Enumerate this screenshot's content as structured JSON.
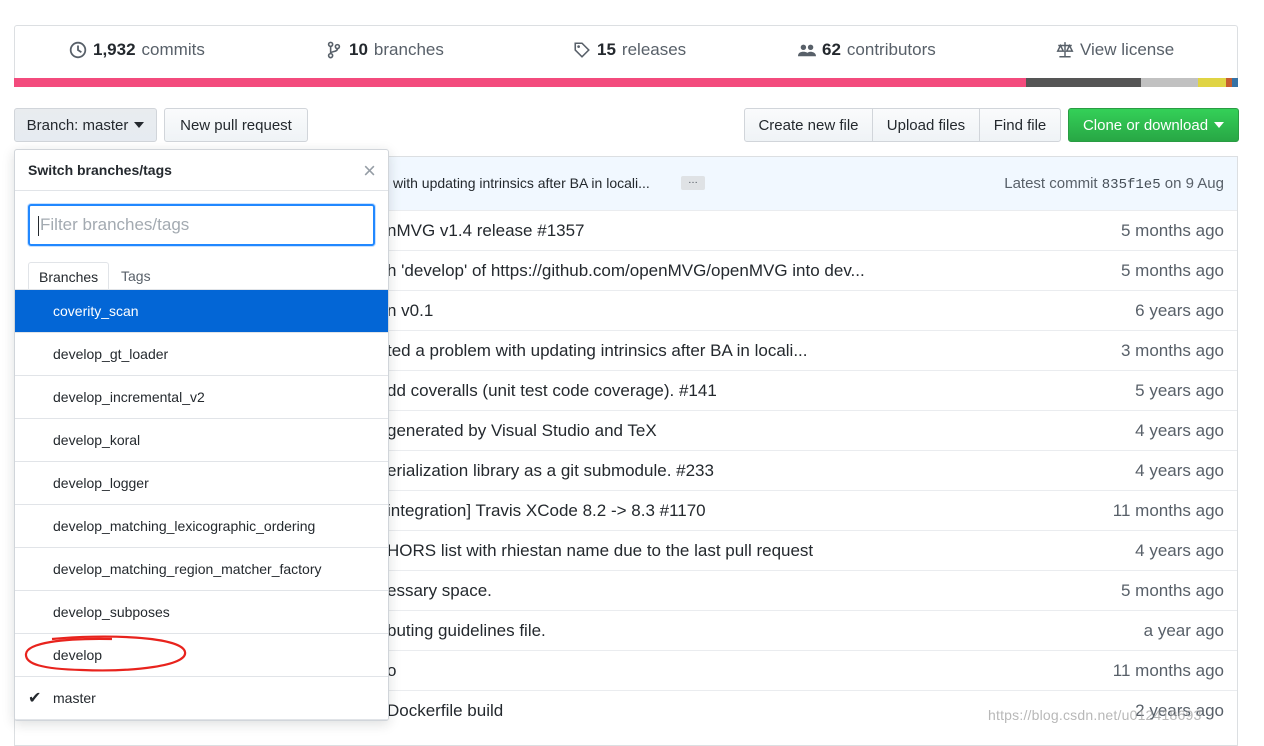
{
  "summary": {
    "commits_count": "1,932",
    "commits_label": "commits",
    "branches_count": "10",
    "branches_label": "branches",
    "releases_count": "15",
    "releases_label": "releases",
    "contributors_count": "62",
    "contributors_label": "contributors",
    "license_label": "View license"
  },
  "language_colors": [
    "#f34b7d",
    "#555555",
    "#c1c1c1",
    "#e0d444",
    "#c65c30",
    "#3572a5"
  ],
  "toolbar": {
    "branch_label": "Branch: master",
    "new_pr": "New pull request",
    "create_file": "Create new file",
    "upload_files": "Upload files",
    "find_file": "Find file",
    "clone": "Clone or download"
  },
  "commit_bar": {
    "message": "with updating intrinsics after BA in locali...",
    "ellipsis": "…",
    "latest_prefix": "Latest commit",
    "sha": "835f1e5",
    "latest_suffix": "on 9 Aug"
  },
  "files": [
    {
      "msg": "nMVG v1.4 release #1357",
      "age": "5 months ago"
    },
    {
      "msg": "h 'develop' of https://github.com/openMVG/openMVG into dev...",
      "age": "5 months ago"
    },
    {
      "msg": "n v0.1",
      "age": "6 years ago"
    },
    {
      "msg": "ted a problem with updating intrinsics after BA in locali...",
      "age": "3 months ago"
    },
    {
      "msg": "dd coveralls (unit test code coverage). #141",
      "age": "5 years ago"
    },
    {
      "msg": "generated by Visual Studio and TeX",
      "age": "4 years ago"
    },
    {
      "msg": "erialization library as a git submodule. #233",
      "age": "4 years ago"
    },
    {
      "msg": "integration] Travis XCode 8.2 -> 8.3 #1170",
      "age": "11 months ago"
    },
    {
      "msg": "HORS list with rhiestan name due to the last pull request",
      "age": "4 years ago"
    },
    {
      "msg": "essary space.",
      "age": "5 months ago"
    },
    {
      "msg": "buting guidelines file.",
      "age": "a year ago"
    },
    {
      "msg": "o",
      "age": "11 months ago"
    },
    {
      "msg": "Dockerfile build",
      "age": "2 years ago"
    }
  ],
  "dropdown": {
    "title": "Switch branches/tags",
    "close": "×",
    "filter_placeholder": "Filter branches/tags",
    "tab_branches": "Branches",
    "tab_tags": "Tags",
    "items": [
      "coverity_scan",
      "develop_gt_loader",
      "develop_incremental_v2",
      "develop_koral",
      "develop_logger",
      "develop_matching_lexicographic_ordering",
      "develop_matching_region_matcher_factory",
      "develop_subposes",
      "develop",
      "master"
    ],
    "selected": "coverity_scan",
    "current": "master",
    "check": "✔"
  },
  "watermark": "https://blog.csdn.net/u012418693"
}
